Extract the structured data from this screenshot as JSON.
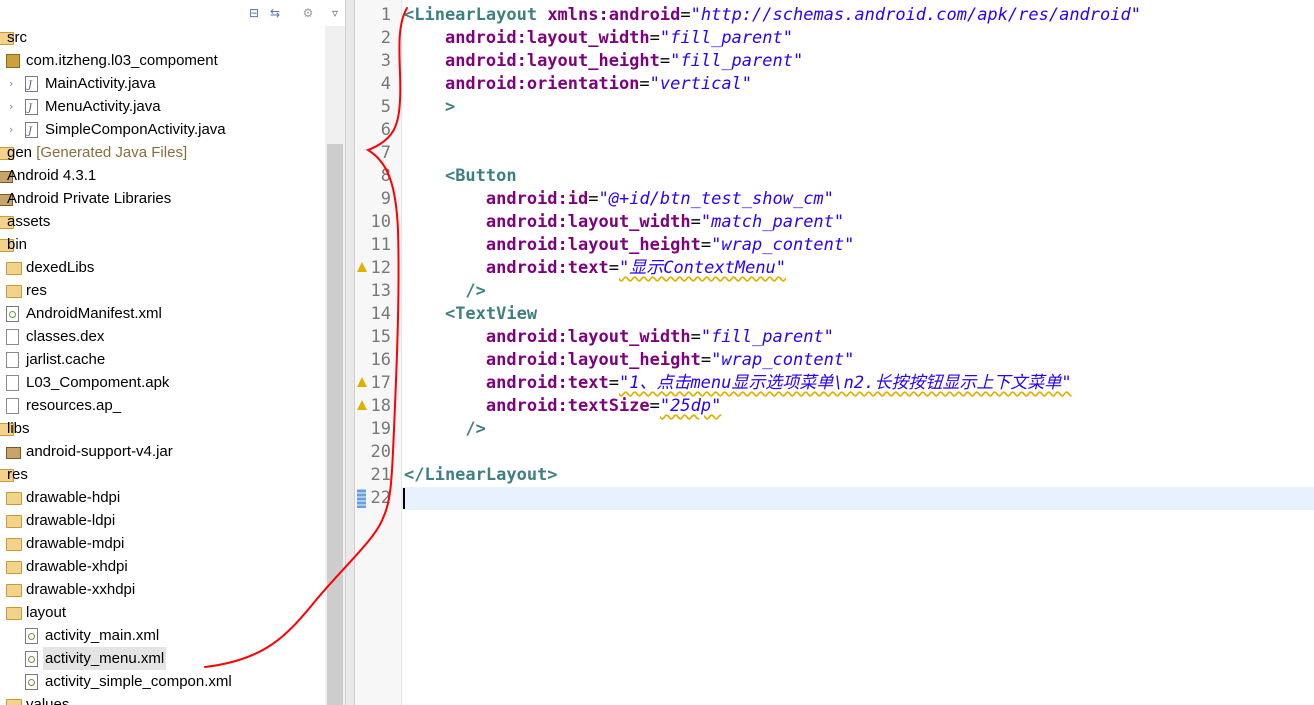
{
  "explorer": {
    "toolbar": {
      "collapse_icon": "collapse-all-icon",
      "link_icon": "link-with-editor-icon",
      "menu_icon": "view-menu-icon",
      "chevron_icon": "dropdown-chevron-icon"
    },
    "tree": [
      {
        "label": "src",
        "icon": "folder",
        "level": 0,
        "chevron": ""
      },
      {
        "label": "com.itzheng.l03_compoment",
        "icon": "pkg",
        "level": 1,
        "chevron": ""
      },
      {
        "label": "MainActivity.java",
        "icon": "jfile",
        "level": 2,
        "chevron": "›"
      },
      {
        "label": "MenuActivity.java",
        "icon": "jfile",
        "level": 2,
        "chevron": "›"
      },
      {
        "label": "SimpleComponActivity.java",
        "icon": "jfile",
        "level": 2,
        "chevron": "›"
      },
      {
        "label": "gen",
        "suffix": "[Generated Java Files]",
        "icon": "folder",
        "level": 0,
        "chevron": ""
      },
      {
        "label": "Android 4.3.1",
        "icon": "jar",
        "level": 0,
        "chevron": ""
      },
      {
        "label": "Android Private Libraries",
        "icon": "jar",
        "level": 0,
        "chevron": ""
      },
      {
        "label": "assets",
        "icon": "folder",
        "level": 0,
        "chevron": ""
      },
      {
        "label": "bin",
        "icon": "folder",
        "level": 0,
        "chevron": ""
      },
      {
        "label": "dexedLibs",
        "icon": "folder",
        "level": 1,
        "chevron": ""
      },
      {
        "label": "res",
        "icon": "folder",
        "level": 1,
        "chevron": ""
      },
      {
        "label": "AndroidManifest.xml",
        "icon": "xfile",
        "level": 1,
        "chevron": ""
      },
      {
        "label": "classes.dex",
        "icon": "file",
        "level": 1,
        "chevron": ""
      },
      {
        "label": "jarlist.cache",
        "icon": "file",
        "level": 1,
        "chevron": ""
      },
      {
        "label": "L03_Compoment.apk",
        "icon": "file",
        "level": 1,
        "chevron": ""
      },
      {
        "label": "resources.ap_",
        "icon": "file",
        "level": 1,
        "chevron": ""
      },
      {
        "label": "libs",
        "icon": "folder",
        "level": 0,
        "chevron": ""
      },
      {
        "label": "android-support-v4.jar",
        "icon": "jar",
        "level": 1,
        "chevron": ""
      },
      {
        "label": "res",
        "icon": "folder",
        "level": 0,
        "chevron": ""
      },
      {
        "label": "drawable-hdpi",
        "icon": "folder",
        "level": 1,
        "chevron": ""
      },
      {
        "label": "drawable-ldpi",
        "icon": "folder",
        "level": 1,
        "chevron": ""
      },
      {
        "label": "drawable-mdpi",
        "icon": "folder",
        "level": 1,
        "chevron": ""
      },
      {
        "label": "drawable-xhdpi",
        "icon": "folder",
        "level": 1,
        "chevron": ""
      },
      {
        "label": "drawable-xxhdpi",
        "icon": "folder",
        "level": 1,
        "chevron": ""
      },
      {
        "label": "layout",
        "icon": "folder",
        "level": 1,
        "chevron": ""
      },
      {
        "label": "activity_main.xml",
        "icon": "xfile",
        "level": 2,
        "chevron": ""
      },
      {
        "label": "activity_menu.xml",
        "icon": "xfile",
        "level": 2,
        "chevron": "",
        "selected": true
      },
      {
        "label": "activity_simple_compon.xml",
        "icon": "xfile",
        "level": 2,
        "chevron": ""
      },
      {
        "label": "values",
        "icon": "folder",
        "level": 1,
        "chevron": ""
      }
    ]
  },
  "editor": {
    "current_line": 22,
    "lines": [
      {
        "n": "1",
        "marker": "",
        "tokens": [
          [
            "tag",
            "<LinearLayout"
          ],
          [
            "plain",
            " "
          ],
          [
            "attr",
            "xmlns:android"
          ],
          [
            "eq",
            "="
          ],
          [
            "val",
            "\"http://schemas.android.com/apk/res/android\""
          ]
        ]
      },
      {
        "n": "2",
        "marker": "",
        "tokens": [
          [
            "plain",
            "    "
          ],
          [
            "attr",
            "android:layout_width"
          ],
          [
            "eq",
            "="
          ],
          [
            "val",
            "\"fill_parent\""
          ]
        ]
      },
      {
        "n": "3",
        "marker": "",
        "tokens": [
          [
            "plain",
            "    "
          ],
          [
            "attr",
            "android:layout_height"
          ],
          [
            "eq",
            "="
          ],
          [
            "val",
            "\"fill_parent\""
          ]
        ]
      },
      {
        "n": "4",
        "marker": "",
        "tokens": [
          [
            "plain",
            "    "
          ],
          [
            "attr",
            "android:orientation"
          ],
          [
            "eq",
            "="
          ],
          [
            "val",
            "\"vertical\""
          ]
        ]
      },
      {
        "n": "5",
        "marker": "",
        "tokens": [
          [
            "plain",
            "    "
          ],
          [
            "tag",
            ">"
          ]
        ]
      },
      {
        "n": "6",
        "marker": "",
        "tokens": []
      },
      {
        "n": "7",
        "marker": "",
        "tokens": []
      },
      {
        "n": "8",
        "marker": "",
        "tokens": [
          [
            "plain",
            "    "
          ],
          [
            "tag",
            "<Button"
          ]
        ]
      },
      {
        "n": "9",
        "marker": "",
        "tokens": [
          [
            "plain",
            "        "
          ],
          [
            "attr",
            "android:id"
          ],
          [
            "eq",
            "="
          ],
          [
            "val",
            "\"@+id/btn_test_show_cm\""
          ]
        ]
      },
      {
        "n": "10",
        "marker": "",
        "tokens": [
          [
            "plain",
            "        "
          ],
          [
            "attr",
            "android:layout_width"
          ],
          [
            "eq",
            "="
          ],
          [
            "val",
            "\"match_parent\""
          ]
        ]
      },
      {
        "n": "11",
        "marker": "",
        "tokens": [
          [
            "plain",
            "        "
          ],
          [
            "attr",
            "android:layout_height"
          ],
          [
            "eq",
            "="
          ],
          [
            "val",
            "\"wrap_content\""
          ]
        ]
      },
      {
        "n": "12",
        "marker": "warn",
        "tokens": [
          [
            "plain",
            "        "
          ],
          [
            "attr",
            "android:text"
          ],
          [
            "eq",
            "="
          ],
          [
            "valw",
            "\"显示ContextMenu\""
          ]
        ]
      },
      {
        "n": "13",
        "marker": "",
        "tokens": [
          [
            "plain",
            "      "
          ],
          [
            "tag",
            "/>"
          ]
        ]
      },
      {
        "n": "14",
        "marker": "",
        "tokens": [
          [
            "plain",
            "    "
          ],
          [
            "tag",
            "<TextView"
          ]
        ]
      },
      {
        "n": "15",
        "marker": "",
        "tokens": [
          [
            "plain",
            "        "
          ],
          [
            "attr",
            "android:layout_width"
          ],
          [
            "eq",
            "="
          ],
          [
            "val",
            "\"fill_parent\""
          ]
        ]
      },
      {
        "n": "16",
        "marker": "",
        "tokens": [
          [
            "plain",
            "        "
          ],
          [
            "attr",
            "android:layout_height"
          ],
          [
            "eq",
            "="
          ],
          [
            "val",
            "\"wrap_content\""
          ]
        ]
      },
      {
        "n": "17",
        "marker": "warn",
        "tokens": [
          [
            "plain",
            "        "
          ],
          [
            "attr",
            "android:text"
          ],
          [
            "eq",
            "="
          ],
          [
            "valw",
            "\"1、点击menu显示选项菜单\\n2.长按按钮显示上下文菜单\""
          ]
        ]
      },
      {
        "n": "18",
        "marker": "warn",
        "tokens": [
          [
            "plain",
            "        "
          ],
          [
            "attr",
            "android:textSize"
          ],
          [
            "eq",
            "="
          ],
          [
            "valw",
            "\"25dp\""
          ]
        ]
      },
      {
        "n": "19",
        "marker": "",
        "tokens": [
          [
            "plain",
            "      "
          ],
          [
            "tag",
            "/>"
          ]
        ]
      },
      {
        "n": "20",
        "marker": "",
        "tokens": []
      },
      {
        "n": "21",
        "marker": "",
        "tokens": [
          [
            "tag",
            "</LinearLayout>"
          ]
        ]
      },
      {
        "n": "22",
        "marker": "bookmark",
        "tokens": []
      }
    ]
  },
  "annotation": {
    "color": "#ff0000",
    "meaning": "hand-drawn red curve"
  }
}
